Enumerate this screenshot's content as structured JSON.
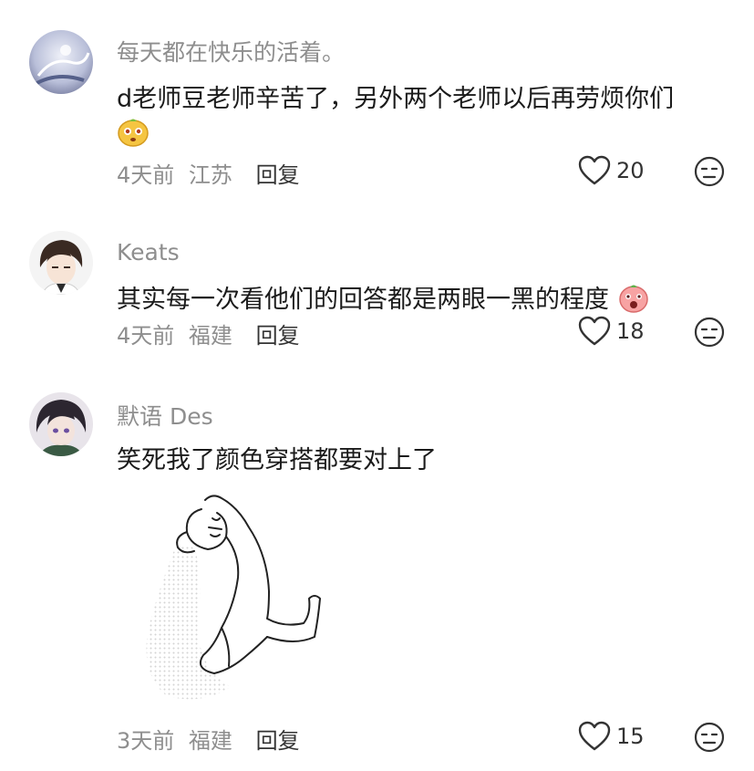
{
  "comments": [
    {
      "username": "每天都在快乐的活着。",
      "text": "d老师豆老师辛苦了，另外两个老师以后再劳烦你们",
      "time": "4天前",
      "location": "江苏",
      "reply_label": "回复",
      "likes": "20",
      "emoji": "face-emoji-yellow"
    },
    {
      "username": "Keats",
      "text": "其实每一次看他们的回答都是两眼一黑的程度",
      "time": "4天前",
      "location": "福建",
      "reply_label": "回复",
      "likes": "18",
      "emoji": "face-emoji-pink"
    },
    {
      "username": "默语 Des",
      "text": "笑死我了颜色穿搭都要对上了",
      "time": "3天前",
      "location": "福建",
      "reply_label": "回复",
      "likes": "15",
      "sticker": "dancing-figure-sticker"
    }
  ],
  "colors": {
    "secondary_text": "#8e8e8e",
    "primary_text": "#1b1b1b"
  }
}
